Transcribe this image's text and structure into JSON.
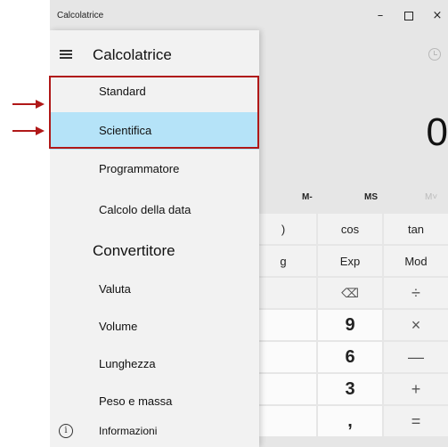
{
  "window": {
    "title": "Calcolatrice",
    "minimize_glyph": "–",
    "close_glyph": "×"
  },
  "display": {
    "value": "0"
  },
  "memory": {
    "m_minus": "M-",
    "ms": "MS",
    "m_star": "M˅"
  },
  "keys": [
    {
      "id": "key-partial-row1",
      "label": ")",
      "type": "fn"
    },
    {
      "id": "key-cos",
      "label": "cos",
      "type": "fn"
    },
    {
      "id": "key-tan",
      "label": "tan",
      "type": "fn"
    },
    {
      "id": "key-partial-row2",
      "label": "g",
      "type": "fn"
    },
    {
      "id": "key-exp",
      "label": "Exp",
      "type": "fn"
    },
    {
      "id": "key-mod",
      "label": "Mod",
      "type": "fn"
    },
    {
      "id": "key-backspace",
      "label": "⌫",
      "type": "op"
    },
    {
      "id": "key-divide",
      "label": "÷",
      "type": "op"
    },
    {
      "id": "key-9",
      "label": "9",
      "type": "num"
    },
    {
      "id": "key-multiply",
      "label": "×",
      "type": "op"
    },
    {
      "id": "key-6",
      "label": "6",
      "type": "num"
    },
    {
      "id": "key-minus",
      "label": "—",
      "type": "op"
    },
    {
      "id": "key-3",
      "label": "3",
      "type": "num"
    },
    {
      "id": "key-plus",
      "label": "+",
      "type": "op"
    },
    {
      "id": "key-comma",
      "label": ",",
      "type": "num"
    },
    {
      "id": "key-equals",
      "label": "=",
      "type": "op"
    }
  ],
  "nav": {
    "title": "Calcolatrice",
    "calculator_items": [
      {
        "label": "Standard",
        "selected": false
      },
      {
        "label": "Scientifica",
        "selected": true
      },
      {
        "label": "Programmatore",
        "selected": false
      },
      {
        "label": "Calcolo della data",
        "selected": false
      }
    ],
    "converter_header": "Convertitore",
    "converter_items": [
      {
        "label": "Valuta"
      },
      {
        "label": "Volume"
      },
      {
        "label": "Lunghezza"
      },
      {
        "label": "Peso e massa"
      }
    ],
    "info_label": "Informazioni"
  },
  "colors": {
    "selected_bg": "#b5e3f8",
    "annotation_red": "#b01818",
    "nav_bg": "#f2f2f2",
    "window_bg": "#e6e6e6"
  },
  "icons": {
    "menu": "hamburger-icon",
    "history": "history-icon",
    "info": "info-icon",
    "arrow": "arrow-right-icon"
  }
}
